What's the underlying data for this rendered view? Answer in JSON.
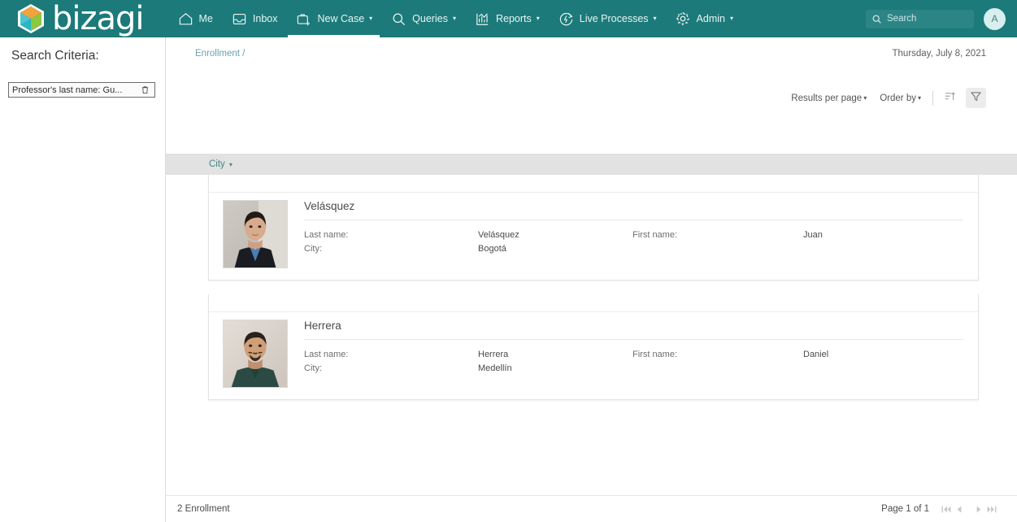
{
  "nav": {
    "brand": "bizagi",
    "items": [
      {
        "label": "Me",
        "icon": "home-icon",
        "caret": false,
        "active": false
      },
      {
        "label": "Inbox",
        "icon": "inbox-icon",
        "caret": false,
        "active": false
      },
      {
        "label": "New Case",
        "icon": "briefcase-add-icon",
        "caret": true,
        "active": true
      },
      {
        "label": "Queries",
        "icon": "search-icon",
        "caret": true,
        "active": false
      },
      {
        "label": "Reports",
        "icon": "chart-icon",
        "caret": true,
        "active": false
      },
      {
        "label": "Live Processes",
        "icon": "live-process-icon",
        "caret": true,
        "active": false
      },
      {
        "label": "Admin",
        "icon": "gear-icon",
        "caret": true,
        "active": false
      }
    ],
    "search_placeholder": "Search",
    "search_value": "",
    "avatar_initial": "A"
  },
  "sidebar": {
    "title": "Search Criteria:",
    "criteria": [
      {
        "text": "Professor's last name: Gu..."
      }
    ]
  },
  "header": {
    "breadcrumb": "Enrollment /",
    "date": "Thursday, July 8, 2021"
  },
  "toolbar": {
    "results_per_page": "Results per page",
    "order_by": "Order by",
    "caret": "▾",
    "sort_icon": "sort-ascending-icon",
    "filter_icon": "funnel-filter-icon"
  },
  "group": {
    "label": "City",
    "caret": "▾"
  },
  "results": {
    "field_labels": {
      "last_name": "Last name:",
      "city": "City:",
      "first_name": "First name:"
    },
    "cards": [
      {
        "title": "Velásquez",
        "photo": "photo-juan-velasquez",
        "last_name": "Velásquez",
        "city": "Bogotá",
        "first_name": "Juan"
      },
      {
        "title": "Herrera",
        "photo": "photo-daniel-herrera",
        "last_name": "Herrera",
        "city": "Medellín",
        "first_name": "Daniel"
      }
    ]
  },
  "footer": {
    "count": "2 Enrollment",
    "page_label": "Page 1 of 1",
    "pager": [
      "first-page-button",
      "previous-page-button",
      "next-page-button",
      "last-page-button"
    ]
  },
  "colors": {
    "brand_teal": "#1c7a7a",
    "search_teal": "#2b8585",
    "group_bar": "#e2e2e2",
    "breadcrumb_link": "#6aa3ab",
    "group_label": "#3f8888"
  }
}
